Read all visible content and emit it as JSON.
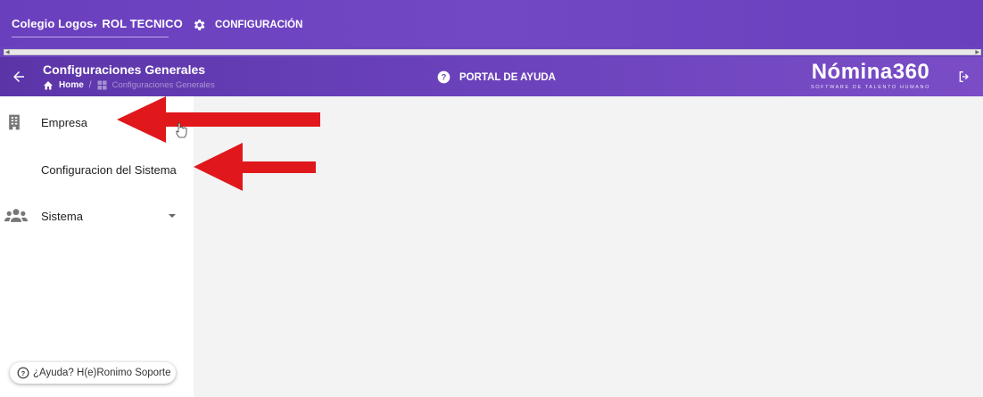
{
  "topbar": {
    "org_name": "Colegio Logos",
    "role": "ROL TECNICO",
    "config_label": "CONFIGURACIÓN"
  },
  "subbar": {
    "title": "Configuraciones Generales",
    "breadcrumb": {
      "home": "Home",
      "separator": "/",
      "current": "Configuraciones Generales"
    },
    "help_portal_label": "PORTAL DE AYUDA",
    "brand": {
      "name": "Nómina360",
      "tagline": "SOFTWARE DE TALENTO HUMANO"
    }
  },
  "sidebar": {
    "items": [
      {
        "label": "Empresa",
        "icon": "building-icon"
      },
      {
        "label": "Configuracion del Sistema",
        "icon": ""
      },
      {
        "label": "Sistema",
        "icon": "users-icon",
        "expandable": true
      }
    ],
    "help_chip": "¿Ayuda? H(e)Ronimo Soporte"
  },
  "colors": {
    "header_purple": "#6a3fbe",
    "annotation_red": "#e0181b"
  }
}
